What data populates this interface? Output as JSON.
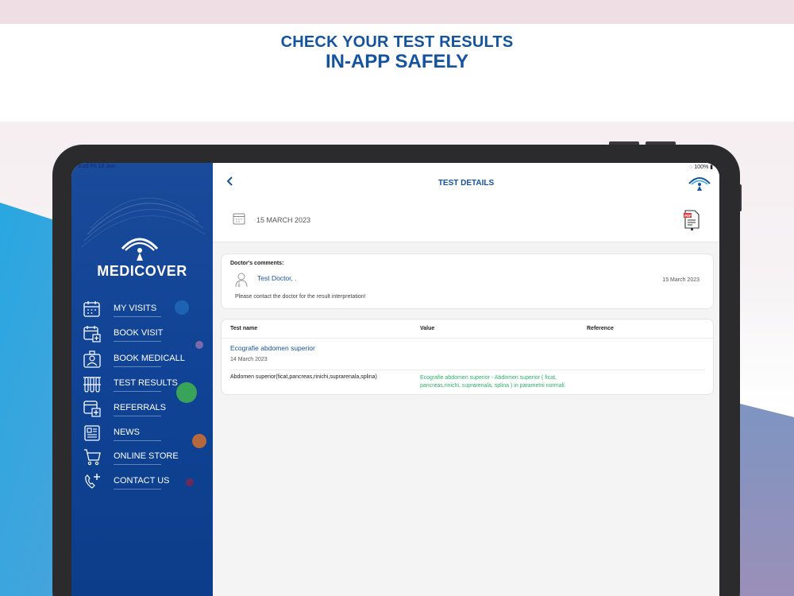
{
  "promo": {
    "headline_line1": "CHECK YOUR TEST RESULTS",
    "headline_line2": "IN-APP SAFELY"
  },
  "status_bar": {
    "time_date": "9:25  Fri 16 Jun",
    "battery": "100%"
  },
  "sidebar": {
    "brand": "MEDICOVER",
    "items": [
      {
        "label": "MY VISITS",
        "icon": "calendar-icon"
      },
      {
        "label": "BOOK VISIT",
        "icon": "calendar-plus-icon"
      },
      {
        "label": "BOOK MEDICALL",
        "icon": "medicall-icon"
      },
      {
        "label": "TEST RESULTS",
        "icon": "test-tubes-icon"
      },
      {
        "label": "REFERRALS",
        "icon": "referral-icon"
      },
      {
        "label": "NEWS",
        "icon": "news-icon"
      },
      {
        "label": "ONLINE STORE",
        "icon": "cart-icon"
      },
      {
        "label": "CONTACT US",
        "icon": "phone-plus-icon"
      }
    ]
  },
  "header": {
    "title": "TEST DETAILS",
    "date": "15 MARCH 2023"
  },
  "comments": {
    "label": "Doctor's comments:",
    "doctor": "Test Doctor,  .",
    "date": "15 March 2023",
    "body": "Please contact the doctor for the result interpretation!"
  },
  "results": {
    "columns": [
      "Test name",
      "Value",
      "Reference"
    ],
    "test_name": "Ecografie abdomen superior",
    "test_date": "14 March 2023",
    "rows": [
      {
        "name": "Abdomen superior(ficat,pancreas,rinichi,suprarenala,splina)",
        "value": "Ecografie abdomen superior - Abdomen superior ( ficat, pancreas,rinichi, suprarenala, splina )  in parametrii normali.",
        "reference": ""
      }
    ]
  },
  "colors": {
    "brand_blue": "#1453a0",
    "sidebar_blue": "#104395",
    "value_green": "#29b36a"
  }
}
